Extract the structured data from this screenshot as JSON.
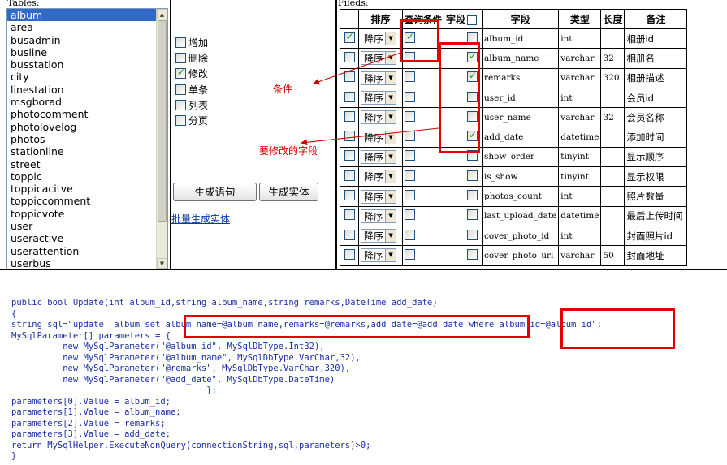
{
  "tables_panel": {
    "label": "Tables:",
    "items": [
      "album",
      "area",
      "busadmin",
      "busline",
      "busstation",
      "city",
      "linestation",
      "msgborad",
      "photocomment",
      "photolovelog",
      "photos",
      "stationline",
      "street",
      "toppic",
      "toppicacitve",
      "toppiccomment",
      "toppicvote",
      "user",
      "useractive",
      "userattention",
      "userbus"
    ],
    "selected": "album"
  },
  "options": {
    "items": [
      {
        "label": "增加",
        "checked": false
      },
      {
        "label": "删除",
        "checked": false
      },
      {
        "label": "修改",
        "checked": true
      },
      {
        "label": "单条",
        "checked": false
      },
      {
        "label": "列表",
        "checked": false
      },
      {
        "label": "分页",
        "checked": false
      }
    ],
    "generate_sql_label": "生成语句",
    "generate_entity_label": "生成实体",
    "batch_link_label": "批量生成实体"
  },
  "fields_panel": {
    "label": "Fileds:",
    "headers": {
      "sort": "排序",
      "query": "查询条件",
      "field_toggle": "字段",
      "field": "字段",
      "type": "类型",
      "length": "长度",
      "note": "备注"
    },
    "sort_value": "降序",
    "rows": [
      {
        "select": true,
        "query": true,
        "field_checked": false,
        "name": "album_id",
        "type": "int",
        "length": "",
        "note": "相册id"
      },
      {
        "select": false,
        "query": false,
        "field_checked": true,
        "name": "album_name",
        "type": "varchar",
        "length": "32",
        "note": "相册名"
      },
      {
        "select": false,
        "query": false,
        "field_checked": true,
        "name": "remarks",
        "type": "varchar",
        "length": "320",
        "note": "相册描述"
      },
      {
        "select": false,
        "query": false,
        "field_checked": false,
        "name": "user_id",
        "type": "int",
        "length": "",
        "note": "会员id"
      },
      {
        "select": false,
        "query": false,
        "field_checked": false,
        "name": "user_name",
        "type": "varchar",
        "length": "32",
        "note": "会员名称"
      },
      {
        "select": false,
        "query": false,
        "field_checked": true,
        "name": "add_date",
        "type": "datetime",
        "length": "",
        "note": "添加时间"
      },
      {
        "select": false,
        "query": false,
        "field_checked": false,
        "name": "show_order",
        "type": "tinyint",
        "length": "",
        "note": "显示顺序"
      },
      {
        "select": false,
        "query": false,
        "field_checked": false,
        "name": "is_show",
        "type": "tinyint",
        "length": "",
        "note": "显示权限"
      },
      {
        "select": false,
        "query": false,
        "field_checked": false,
        "name": "photos_count",
        "type": "int",
        "length": "",
        "note": "照片数量"
      },
      {
        "select": false,
        "query": false,
        "field_checked": false,
        "name": "last_upload_date",
        "type": "datetime",
        "length": "",
        "note": "最后上传时间"
      },
      {
        "select": false,
        "query": false,
        "field_checked": false,
        "name": "cover_photo_id",
        "type": "int",
        "length": "",
        "note": "封面照片id"
      },
      {
        "select": false,
        "query": false,
        "field_checked": false,
        "name": "cover_photo_url",
        "type": "varchar",
        "length": "50",
        "note": "封面地址"
      }
    ]
  },
  "annotations": {
    "condition": "条件",
    "fields_to_modify": "要修改的字段",
    "color": "#e60000"
  },
  "code": {
    "lines": [
      "public bool Update(int album_id,string album_name,string remarks,DateTime add_date)",
      "{",
      "string sql=\"update  album set album_name=@album_name,remarks=@remarks,add_date=@add_date where album_id=@album_id\";",
      "MySqlParameter[] parameters = {",
      "          new MySqlParameter(\"@album_id\", MySqlDbType.Int32),",
      "          new MySqlParameter(\"@album_name\", MySqlDbType.VarChar,32),",
      "          new MySqlParameter(\"@remarks\", MySqlDbType.VarChar,320),",
      "          new MySqlParameter(\"@add_date\", MySqlDbType.DateTime)",
      "                                      };",
      "parameters[0].Value = album_id;",
      "parameters[1].Value = album_name;",
      "parameters[2].Value = remarks;",
      "parameters[3].Value = add_date;",
      "return MySqlHelper.ExecuteNonQuery(connectionString,sql,parameters)>0;",
      "}"
    ],
    "color": "#1b2fa6"
  }
}
